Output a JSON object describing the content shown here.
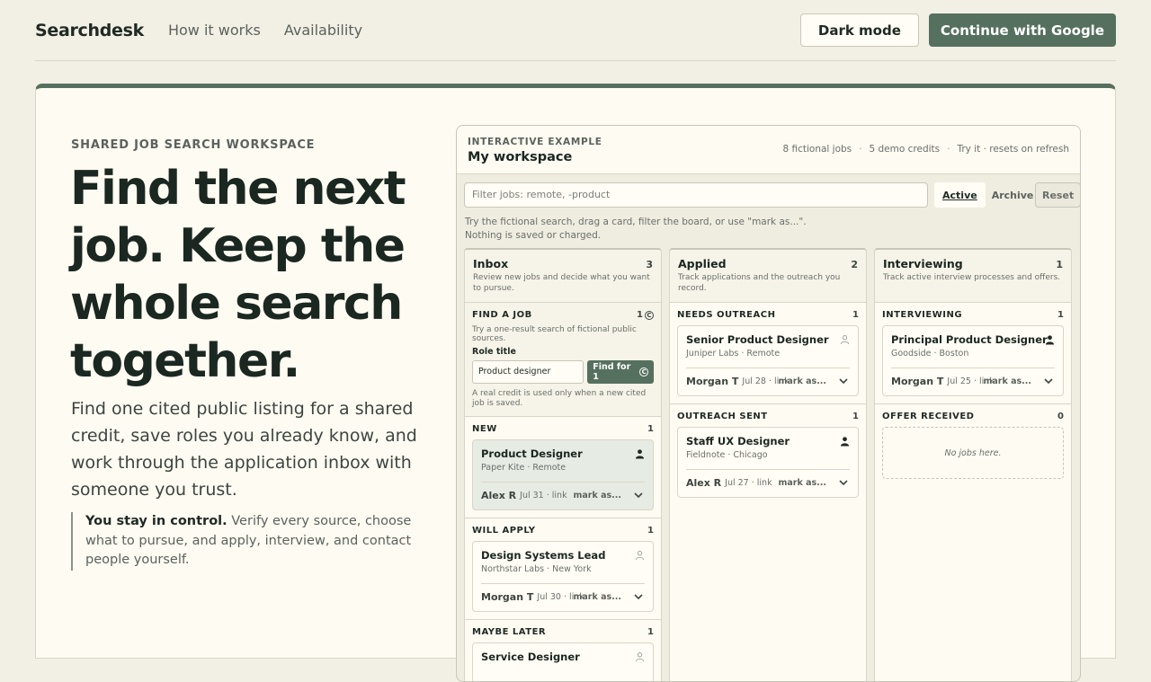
{
  "nav": {
    "brand": "Searchdesk",
    "links": [
      "How it works",
      "Availability"
    ],
    "dark_mode": "Dark mode",
    "google": "Continue with Google"
  },
  "hero": {
    "eyebrow": "SHARED JOB SEARCH WORKSPACE",
    "headline": "Find the next job. Keep the whole search together.",
    "lede": "Find one cited public listing for a shared credit, save roles you already know, and work through the application inbox with someone you trust.",
    "quote_strong": "You stay in control.",
    "quote_rest": " Verify every source, choose what to pursue, and apply, interview, and contact people yourself."
  },
  "workspace": {
    "eyebrow": "INTERACTIVE EXAMPLE",
    "title": "My workspace",
    "meta": [
      "8 fictional jobs",
      "5 demo credits",
      "Try it · resets on refresh"
    ],
    "filter_placeholder": "Filter jobs: remote, -product",
    "tabs": [
      "Active",
      "Archive"
    ],
    "reset": "Reset",
    "hint": "Try the fictional search, drag a card, filter the board, or use \"mark as...\". Nothing is saved or charged.",
    "columns": [
      {
        "title": "Inbox",
        "count": "3",
        "sub": "Review new jobs and decide what you want to pursue.",
        "find": {
          "title": "FIND A JOB",
          "count": "1",
          "sub": "Try a one-result search of fictional public sources.",
          "label": "Role title",
          "value": "Product designer",
          "button": "Find for 1",
          "note": "A real credit is used only when a new cited job is saved."
        },
        "sections": [
          {
            "title": "NEW",
            "count": "1",
            "job": {
              "title": "Product Designer",
              "sub": "Paper Kite · Remote",
              "owner": "Alex R",
              "date": "Jul 31 · link",
              "mark": "mark as..."
            }
          },
          {
            "title": "WILL APPLY",
            "count": "1",
            "job": {
              "title": "Design Systems Lead",
              "sub": "Northstar Labs · New York",
              "owner": "Morgan T",
              "date": "Jul 30 · link",
              "mark": "mark as..."
            }
          },
          {
            "title": "MAYBE LATER",
            "count": "1",
            "job": {
              "title": "Service Designer"
            }
          }
        ]
      },
      {
        "title": "Applied",
        "count": "2",
        "sub": "Track applications and the outreach you record.",
        "sections": [
          {
            "title": "NEEDS OUTREACH",
            "count": "1",
            "job": {
              "title": "Senior Product Designer",
              "sub": "Juniper Labs · Remote",
              "owner": "Morgan T",
              "date": "Jul 28 · link",
              "mark": "mark as..."
            }
          },
          {
            "title": "OUTREACH SENT",
            "count": "1",
            "job": {
              "title": "Staff UX Designer",
              "sub": "Fieldnote · Chicago",
              "owner": "Alex R",
              "date": "Jul 27 · link",
              "mark": "mark as..."
            }
          }
        ]
      },
      {
        "title": "Interviewing",
        "count": "1",
        "sub": "Track active interview processes and offers.",
        "sections": [
          {
            "title": "INTERVIEWING",
            "count": "1",
            "job": {
              "title": "Principal Product Designer",
              "sub": "Goodside · Boston",
              "owner": "Morgan T",
              "date": "Jul 25 · link",
              "mark": "mark as..."
            }
          },
          {
            "title": "OFFER RECEIVED",
            "count": "0",
            "empty": "No jobs here."
          }
        ]
      }
    ]
  }
}
